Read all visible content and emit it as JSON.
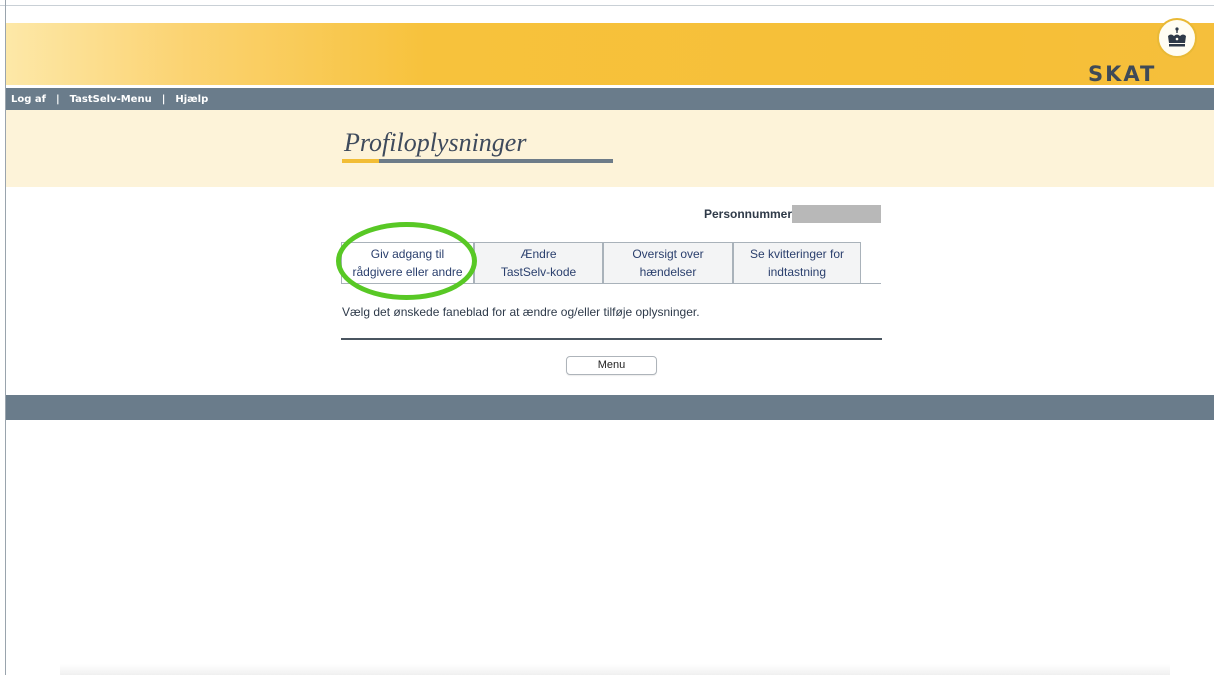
{
  "header": {
    "logo_text": "SKAT",
    "logo_icon": "crown-icon",
    "brand_color": "#f6bf37",
    "nav_color": "#6a7c8b"
  },
  "nav": {
    "items": [
      "Log af",
      "TastSelv-Menu",
      "Hjælp"
    ],
    "separator": "|"
  },
  "page": {
    "title": "Profiloplysninger",
    "person_label": "Personnummer:",
    "instruction": "Vælg det ønskede faneblad for at ændre og/eller tilføje oplysninger.",
    "menu_button": "Menu"
  },
  "tabs": [
    {
      "line1": "Giv adgang til",
      "line2": "rådgivere eller andre",
      "active": true
    },
    {
      "line1": "Ændre",
      "line2": "TastSelv-kode",
      "active": false
    },
    {
      "line1": "Oversigt over",
      "line2": "hændelser",
      "active": false
    },
    {
      "line1": "Se kvitteringer for",
      "line2": "indtastning",
      "active": false
    }
  ],
  "annotation": {
    "highlight_color": "#58c825"
  }
}
